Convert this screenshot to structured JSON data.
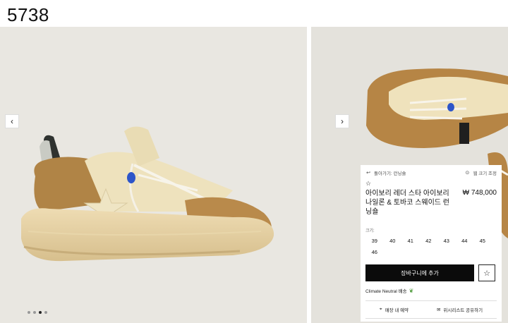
{
  "header": {
    "label": "5738"
  },
  "gallery": {
    "prev_glyph": "‹",
    "next_glyph": "›",
    "dots_total": 4,
    "dots_active_index": 2
  },
  "panel": {
    "back_label": "돌아가기: 런닝숄",
    "size_guide_label": "웹 크기 조정",
    "title": "아이보리 레더 스타 아이보리 나일론 & 토바코 스웨이드 런닝숄",
    "price": "₩ 748,000",
    "size_label": "크기:",
    "sizes": [
      "39",
      "40",
      "41",
      "42",
      "43",
      "44",
      "45",
      "46"
    ],
    "cart_label": "장바구니에 추가",
    "climate_label": "Climate Neutral 배송",
    "store_label": "매장 내 예약",
    "share_label": "위시리스트 공유하기"
  },
  "colors": {
    "cart_bg": "#0b0b0b",
    "leaf": "#4d9a3a",
    "backdrop": "#e7e5df"
  },
  "icons": [
    "back-arrow-icon",
    "size-guide-icon",
    "star-outline-icon",
    "wishlist-star-icon",
    "leaf-icon",
    "location-pin-icon",
    "mail-icon"
  ]
}
